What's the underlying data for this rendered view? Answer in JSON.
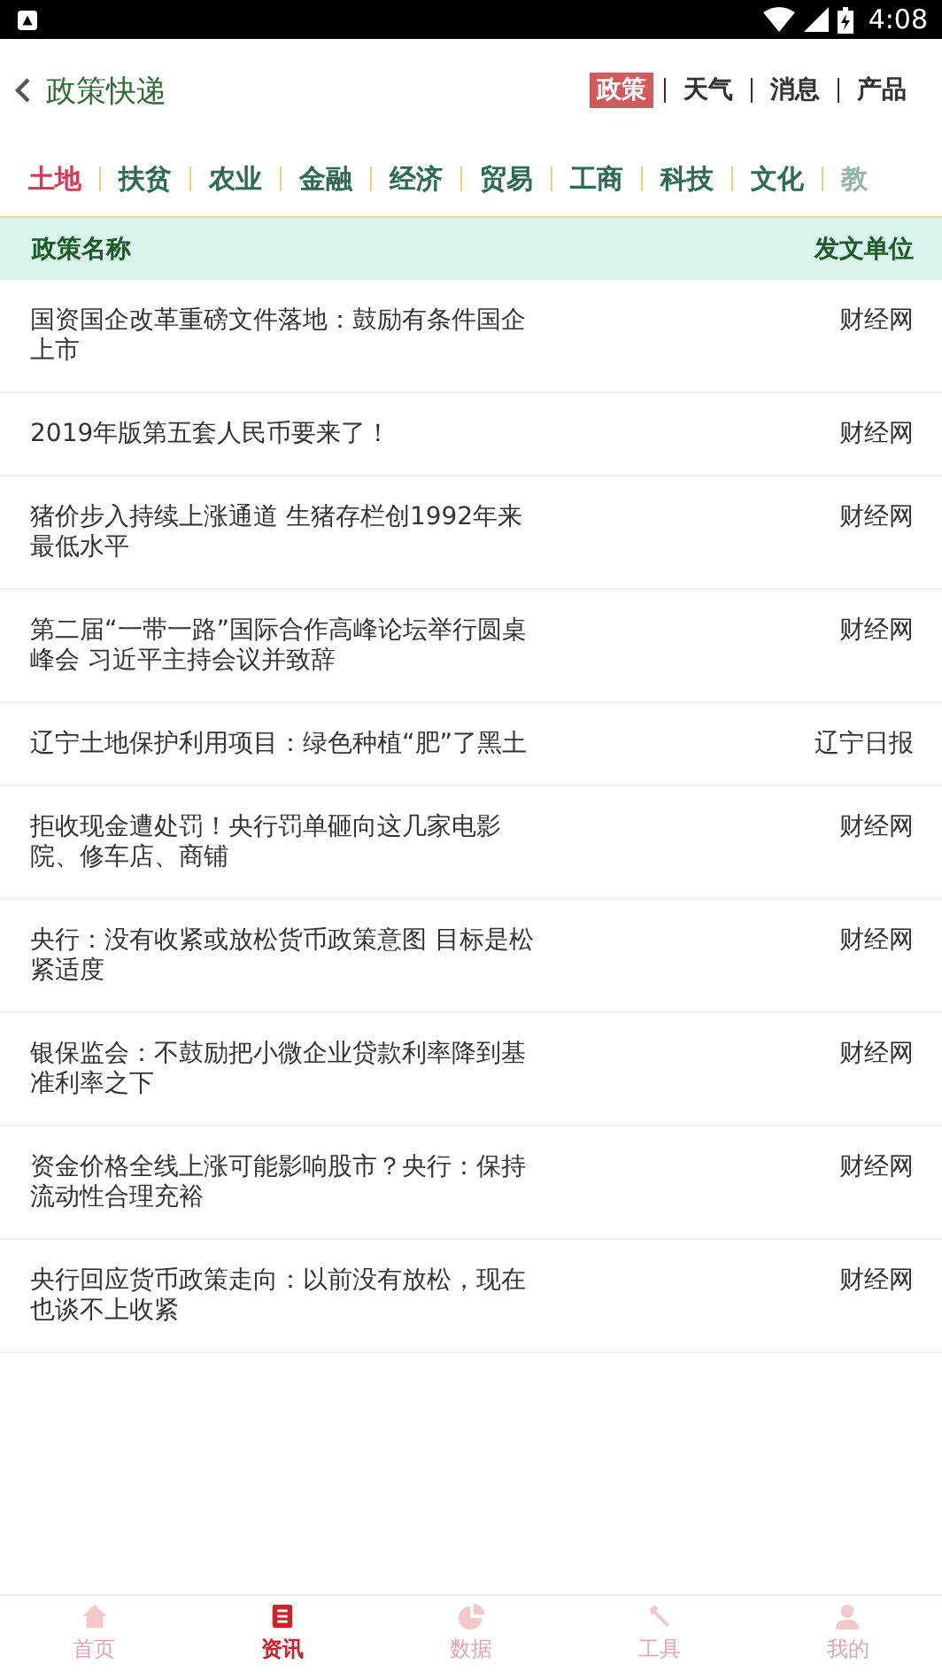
{
  "status_bar": {
    "time": "4:08"
  },
  "header": {
    "title": "政策快递",
    "tabs": [
      {
        "label": "政策",
        "selected": true
      },
      {
        "label": "天气",
        "selected": false
      },
      {
        "label": "消息",
        "selected": false
      },
      {
        "label": "产品",
        "selected": false
      }
    ]
  },
  "categories": [
    {
      "label": "土地",
      "selected": true
    },
    {
      "label": "扶贫",
      "selected": false
    },
    {
      "label": "农业",
      "selected": false
    },
    {
      "label": "金融",
      "selected": false
    },
    {
      "label": "经济",
      "selected": false
    },
    {
      "label": "贸易",
      "selected": false
    },
    {
      "label": "工商",
      "selected": false
    },
    {
      "label": "科技",
      "selected": false
    },
    {
      "label": "文化",
      "selected": false
    },
    {
      "label": "教",
      "selected": false
    }
  ],
  "table": {
    "columns": [
      "政策名称",
      "发文单位"
    ],
    "rows": [
      {
        "title": "国资国企改革重磅文件落地：鼓励有条件国企上市",
        "source": "财经网"
      },
      {
        "title": "2019年版第五套人民币要来了！",
        "source": "财经网"
      },
      {
        "title": "猪价步入持续上涨通道 生猪存栏创1992年来最低水平",
        "source": "财经网"
      },
      {
        "title": "第二届“一带一路”国际合作高峰论坛举行圆桌峰会 习近平主持会议并致辞",
        "source": "财经网"
      },
      {
        "title": "辽宁土地保护利用项目：绿色种植“肥”了黑土",
        "source": "辽宁日报"
      },
      {
        "title": "拒收现金遭处罚！央行罚单砸向这几家电影院、修车店、商铺",
        "source": "财经网"
      },
      {
        "title": "央行：没有收紧或放松货币政策意图 目标是松紧适度",
        "source": "财经网"
      },
      {
        "title": "银保监会：不鼓励把小微企业贷款利率降到基准利率之下",
        "source": "财经网"
      },
      {
        "title": "资金价格全线上涨可能影响股市？央行：保持流动性合理充裕",
        "source": "财经网"
      },
      {
        "title": "央行回应货币政策走向：以前没有放松，现在也谈不上收紧",
        "source": "财经网"
      }
    ]
  },
  "bottom_nav": [
    {
      "label": "首页",
      "kind": "home",
      "selected": false
    },
    {
      "label": "资讯",
      "kind": "news",
      "selected": true
    },
    {
      "label": "数据",
      "kind": "data",
      "selected": false
    },
    {
      "label": "工具",
      "kind": "tools",
      "selected": false
    },
    {
      "label": "我的",
      "kind": "profile",
      "selected": false
    }
  ]
}
